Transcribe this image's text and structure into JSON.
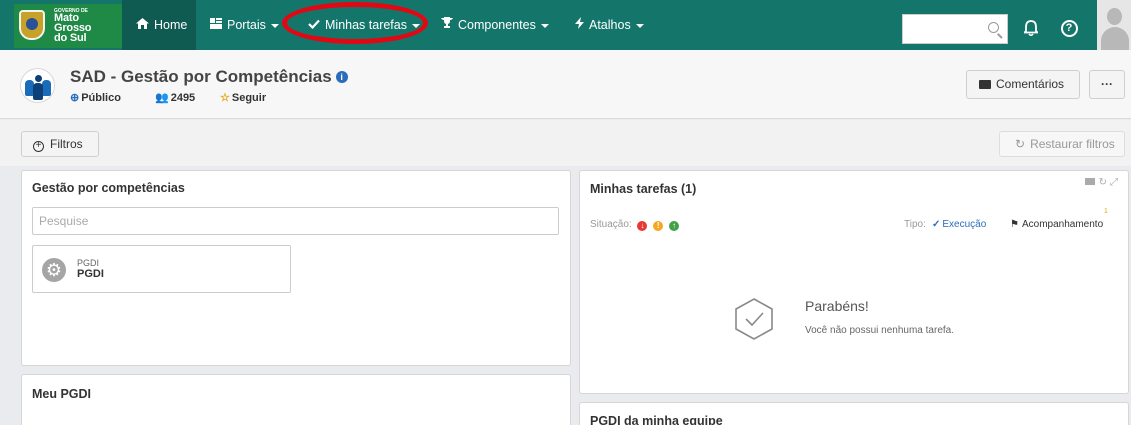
{
  "header": {
    "logo": {
      "small": "GOVERNO DE",
      "lines": [
        "Mato",
        "Grosso",
        "do Sul"
      ]
    },
    "nav": [
      {
        "label": "Home",
        "icon": "home-icon",
        "active": true
      },
      {
        "label": "Portais",
        "icon": "portals-icon",
        "dropdown": true
      },
      {
        "label": "Minhas tarefas",
        "icon": "check-icon",
        "dropdown": true,
        "highlighted": true
      },
      {
        "label": "Componentes",
        "icon": "trophy-icon",
        "dropdown": true
      },
      {
        "label": "Atalhos",
        "icon": "bolt-icon",
        "dropdown": true
      }
    ],
    "search_placeholder": "",
    "icons": [
      "search-icon",
      "bell-icon",
      "help-icon",
      "avatar"
    ],
    "highlight_color": "#e30613",
    "bar_color": "#14766a"
  },
  "community": {
    "title": "SAD - Gestão por Competências",
    "visibility": "Público",
    "members": "2495",
    "follow": "Seguir",
    "comments_button": "Comentários",
    "more_button": "···"
  },
  "filters": {
    "filter_button": "Filtros",
    "restore_button": "Restaurar filtros"
  },
  "gestao": {
    "title": "Gestão por competências",
    "search_placeholder": "Pesquise",
    "item": {
      "subtitle": "PGDI",
      "title": "PGDI"
    }
  },
  "tarefas": {
    "title": "Minhas tarefas (1)",
    "situacao_label": "Situação:",
    "tipo_label": "Tipo:",
    "tipo_options": [
      "Execução",
      "Acompanhamento"
    ],
    "badge": "1",
    "empty_title": "Parabéns!",
    "empty_text": "Você não possui nenhuma tarefa."
  },
  "meu_pgdi": {
    "title": "Meu PGDI"
  },
  "equipe": {
    "title": "PGDI da minha equipe"
  }
}
